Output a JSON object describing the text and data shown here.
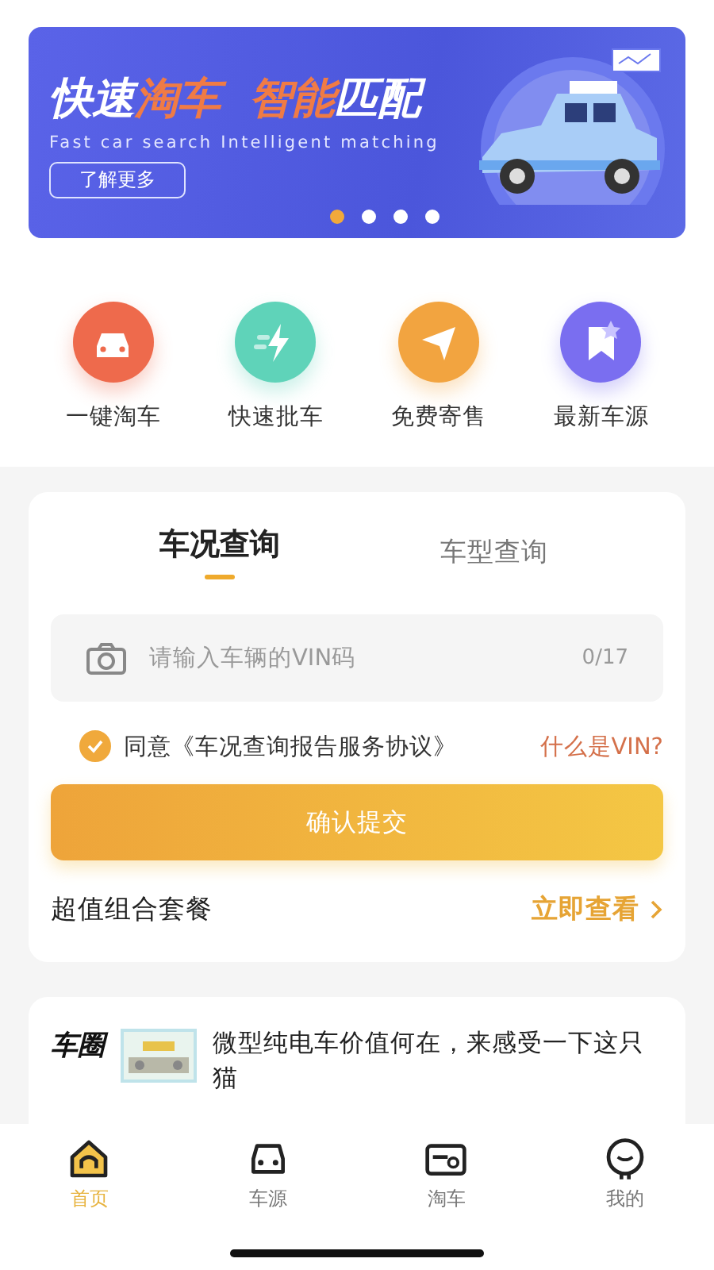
{
  "banner": {
    "headline": [
      [
        {
          "text": "快速",
          "accent": false
        },
        {
          "text": "淘车",
          "accent": true
        }
      ],
      [
        {
          "text": "智能",
          "accent": true
        },
        {
          "text": "匹配",
          "accent": false
        }
      ]
    ],
    "subtitle": "Fast car search Intelligent matching",
    "button": "了解更多",
    "dots": [
      {
        "selected": true
      },
      {
        "selected": false
      },
      {
        "selected": false
      },
      {
        "selected": false
      }
    ]
  },
  "quick_actions": [
    {
      "kind": "car",
      "label": "一键淘车",
      "color": "#ee6a4c"
    },
    {
      "kind": "bolt",
      "label": "快速批车",
      "color": "#5fd3b9"
    },
    {
      "kind": "plane",
      "label": "免费寄售",
      "color": "#f2a440"
    },
    {
      "kind": "bookmark",
      "label": "最新车源",
      "color": "#7a6ef0"
    }
  ],
  "query": {
    "tabs": [
      {
        "label": "车况查询",
        "selected": true
      },
      {
        "label": "车型查询",
        "selected": false
      }
    ],
    "vin_field": {
      "placeholder": "请输入车辆的VIN码",
      "counter": "0/17"
    },
    "agreement": {
      "checked": true,
      "text": "同意《车况查询报告服务协议》"
    },
    "help_link": "什么是VIN?",
    "submit": "确认提交",
    "package": {
      "title": "超值组合套餐",
      "link": "立即查看"
    }
  },
  "news": {
    "logo": "车圈",
    "headline": "微型纯电车价值何在，来感受一下这只猫"
  },
  "tab_bar": [
    {
      "kind": "home",
      "label": "首页",
      "selected": true
    },
    {
      "kind": "car",
      "label": "车源",
      "selected": false
    },
    {
      "kind": "ticket",
      "label": "淘车",
      "selected": false
    },
    {
      "kind": "face",
      "label": "我的",
      "selected": false
    }
  ]
}
